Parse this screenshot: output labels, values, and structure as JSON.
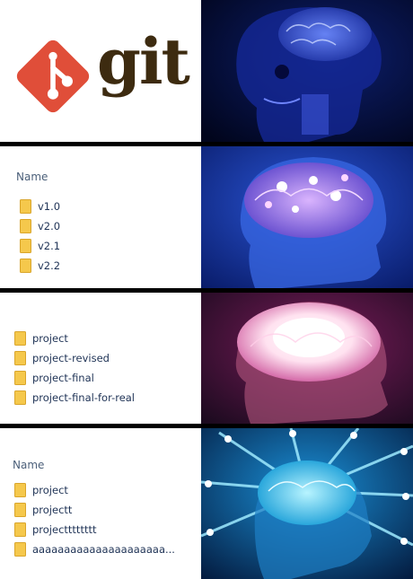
{
  "panels": [
    {
      "logo": {
        "word": "git",
        "mark_color": "#e04e39",
        "word_color": "#3d2b10"
      }
    },
    {
      "header": "Name",
      "items": [
        "v1.0",
        "v2.0",
        "v2.1",
        "v2.2"
      ]
    },
    {
      "items": [
        "project",
        "project-revised",
        "project-final",
        "project-final-for-real"
      ]
    },
    {
      "header": "Name",
      "items": [
        "project",
        "projectt",
        "projectttttttt",
        "aaaaaaaaaaaaaaaaaaaaa..."
      ]
    }
  ],
  "colors": {
    "folder": "#f5c84c",
    "folder_edge": "#d9a52b",
    "list_text": "#1e3255",
    "header_text": "#4c607a"
  }
}
